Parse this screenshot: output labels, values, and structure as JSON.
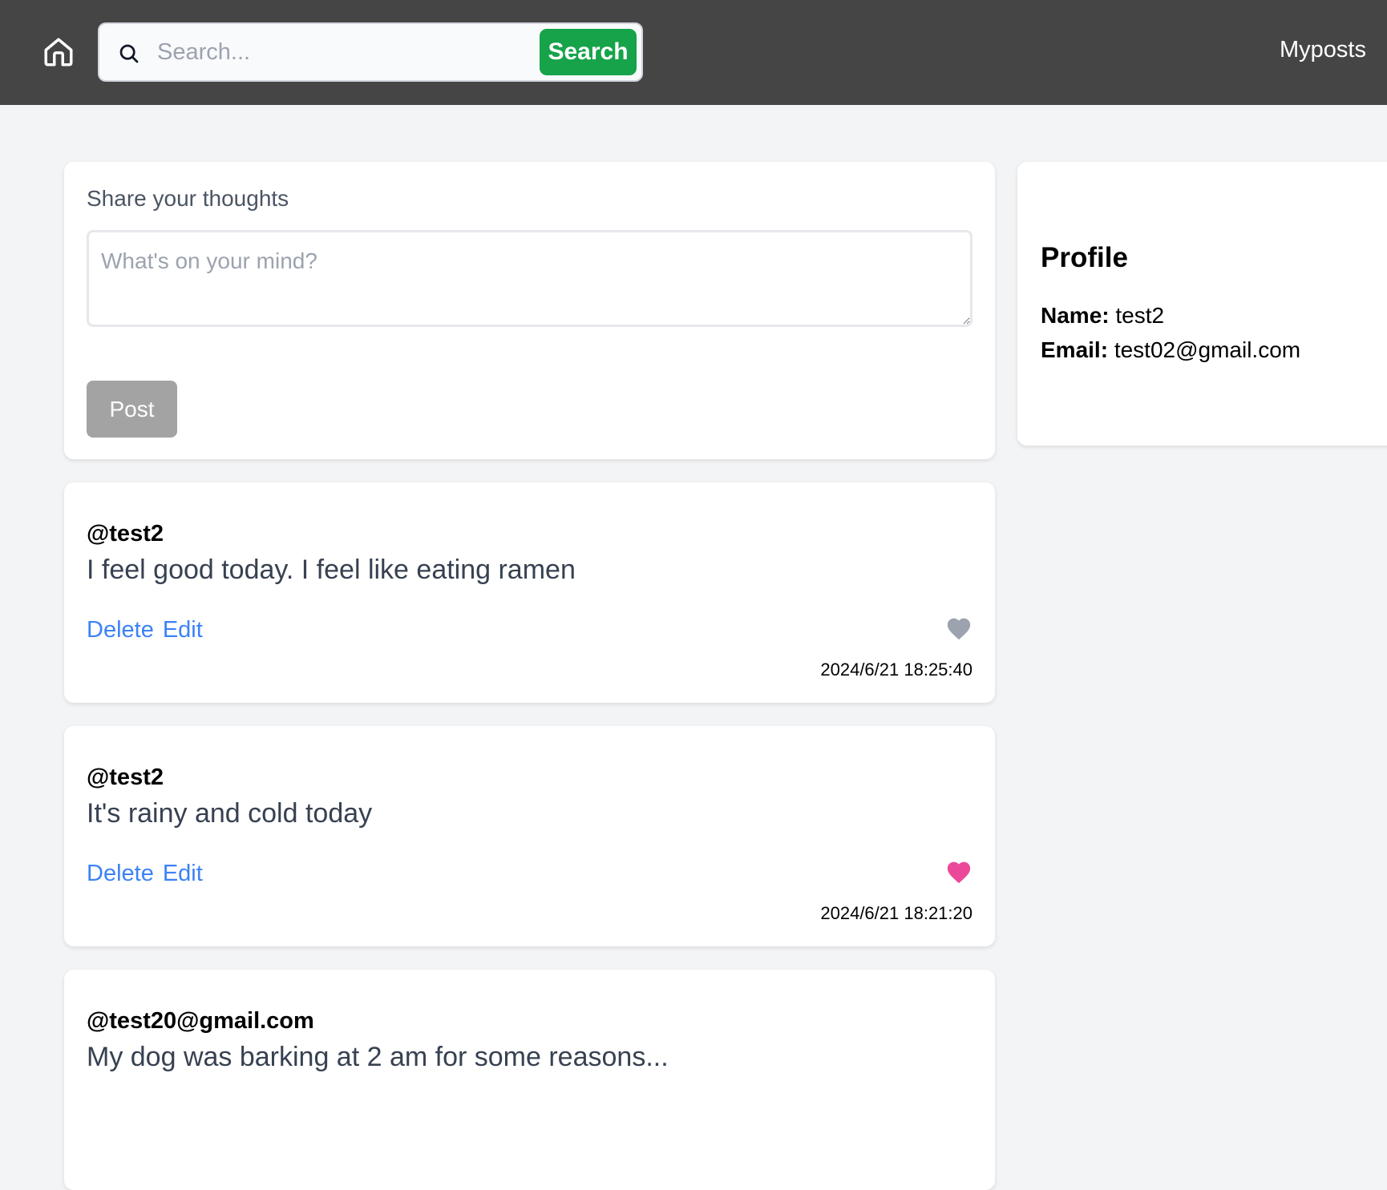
{
  "nav": {
    "search_placeholder": "Search...",
    "search_button": "Search",
    "myposts_label": "Myposts"
  },
  "compose": {
    "label": "Share your thoughts",
    "placeholder": "What's on your mind?",
    "post_button": "Post"
  },
  "profile": {
    "title": "Profile",
    "name_label": "Name:",
    "name_value": "test2",
    "email_label": "Email:",
    "email_value": "test02@gmail.com"
  },
  "posts": [
    {
      "author": "@test2",
      "content": "I feel good today. I feel like eating ramen",
      "delete_label": "Delete",
      "edit_label": "Edit",
      "liked": false,
      "like_icon": "heart-icon",
      "like_color": "#9ca3af",
      "timestamp": "2024/6/21 18:25:40"
    },
    {
      "author": "@test2",
      "content": "It's rainy and cold today",
      "delete_label": "Delete",
      "edit_label": "Edit",
      "liked": true,
      "like_icon": "heart-icon",
      "like_color": "#ec4899",
      "timestamp": "2024/6/21 18:21:20"
    },
    {
      "author": "@test20@gmail.com",
      "content": "My dog was barking at 2 am for some reasons..."
    }
  ],
  "colors": {
    "navbar": "#454545",
    "search_button": "#16a34a",
    "link": "#3b82f6",
    "like_active": "#ec4899",
    "like_inactive": "#9ca3af",
    "post_button_disabled": "#a3a3a3"
  }
}
